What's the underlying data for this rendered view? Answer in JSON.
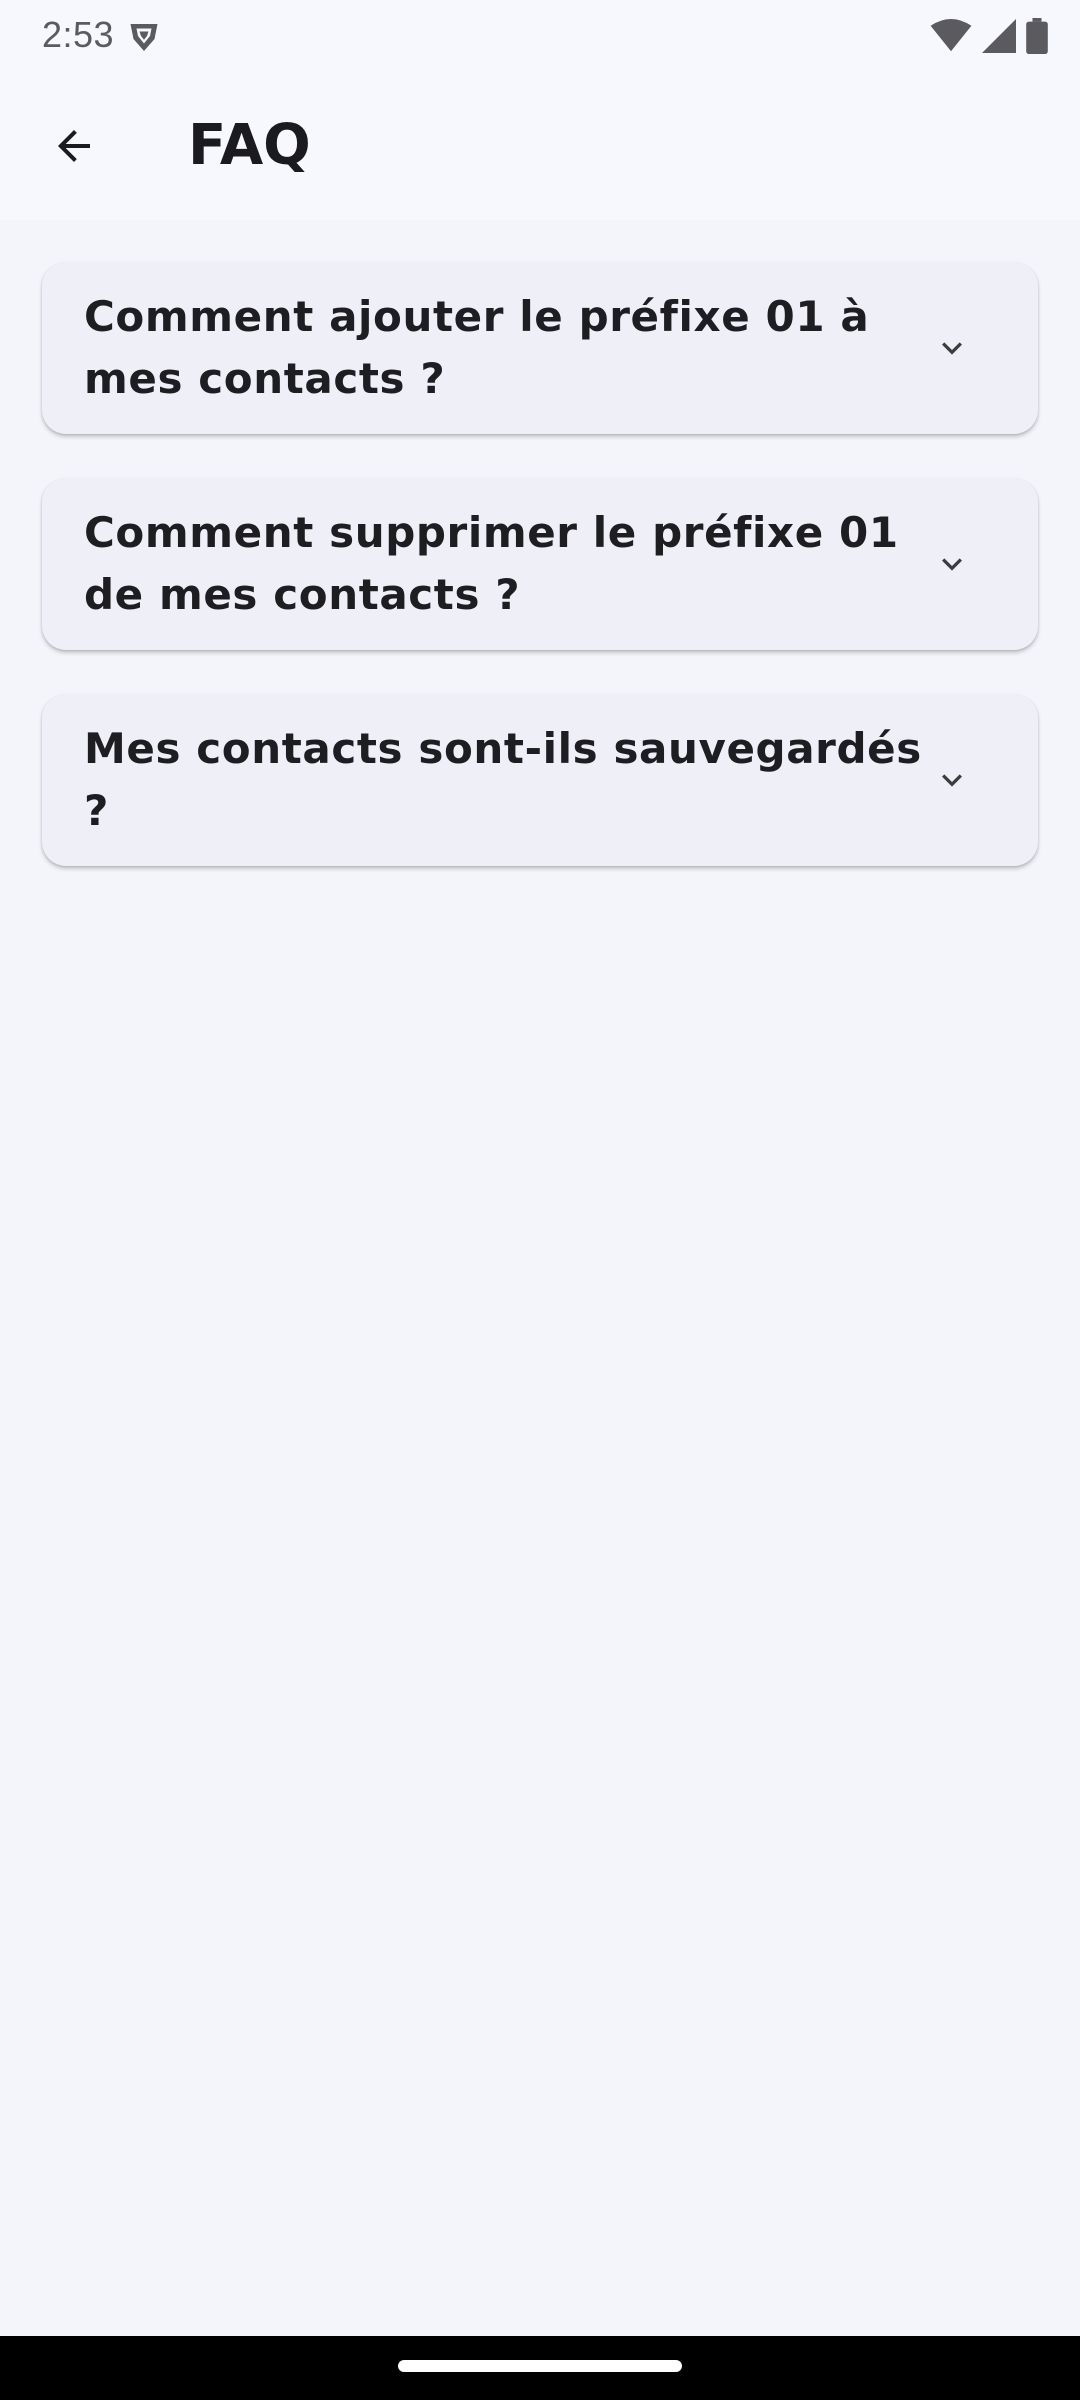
{
  "status_bar": {
    "time": "2:53",
    "left_icons": [
      "shield-icon"
    ],
    "right_icons": [
      "wifi-icon",
      "signal-icon",
      "battery-icon"
    ]
  },
  "app_bar": {
    "back_icon": "arrow-left-icon",
    "title": "FAQ"
  },
  "faq": {
    "items": [
      {
        "question": "Comment ajouter le préfixe 01 à mes contacts ?",
        "icon": "chevron-down-icon",
        "expanded": false
      },
      {
        "question": "Comment supprimer le préfixe 01 de mes contacts ?",
        "icon": "chevron-down-icon",
        "expanded": false
      },
      {
        "question": "Mes contacts sont-ils sauvegardés ?",
        "icon": "chevron-down-icon",
        "expanded": false
      }
    ]
  },
  "colors": {
    "background": "#f4f5fa",
    "card": "#efeff8",
    "text": "#1b1b1f",
    "nav_bar": "#000000"
  }
}
